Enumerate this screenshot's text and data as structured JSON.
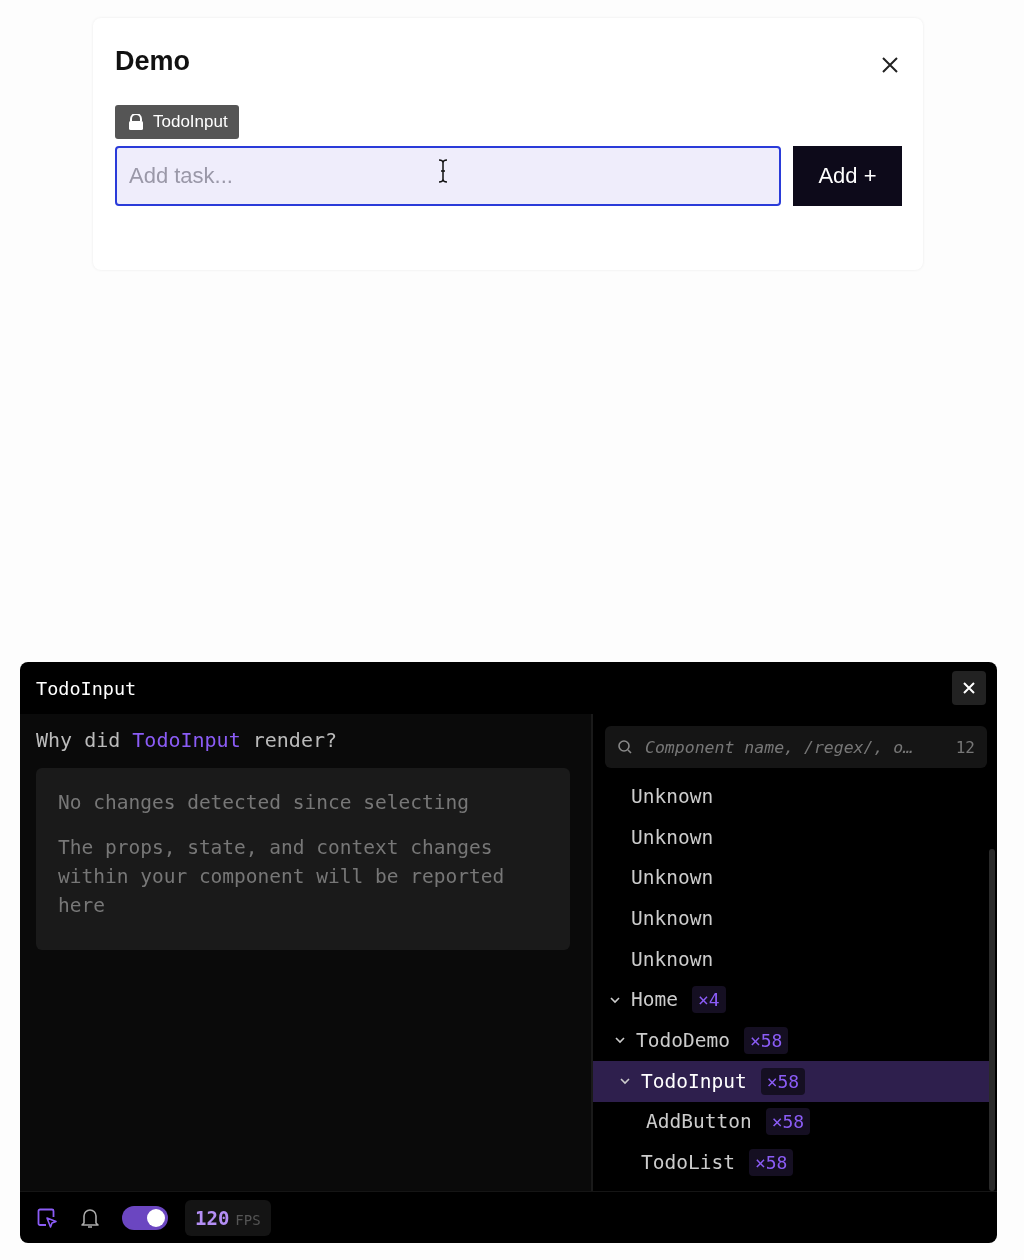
{
  "demo": {
    "title": "Demo",
    "highlight_label": "TodoInput",
    "input": {
      "placeholder": "Add task..."
    },
    "add_button": "Add +"
  },
  "inspector": {
    "title": "TodoInput",
    "why": "Why did **TodoInput** render?",
    "messages": [
      "No changes detected since selecting",
      "The props, state, and context changes within your component will be reported here"
    ],
    "search": {
      "placeholder": "Component name, /regex/, o…",
      "count": "12"
    },
    "tree": [
      {
        "name": "Unknown",
        "selected": false
      },
      {
        "name": "Unknown",
        "selected": false
      },
      {
        "name": "Unknown",
        "selected": false
      },
      {
        "name": "Unknown",
        "selected": false
      },
      {
        "name": "Unknown",
        "selected": false
      },
      {
        "name": "Home",
        "count": "×4",
        "expanded": true,
        "selected": false,
        "children": [
          {
            "name": "TodoDemo",
            "count": "×58",
            "expanded": true,
            "selected": false,
            "children": [
              {
                "name": "TodoInput",
                "count": "×58",
                "expanded": true,
                "selected": true,
                "children": [
                  {
                    "name": "AddButton",
                    "count": "×58",
                    "selected": false
                  }
                ]
              },
              {
                "name": "TodoList",
                "count": "×58",
                "selected": false
              }
            ]
          }
        ]
      }
    ],
    "footer": {
      "toggle_on": true,
      "fps": "120",
      "fps_unit": "FPS"
    }
  }
}
